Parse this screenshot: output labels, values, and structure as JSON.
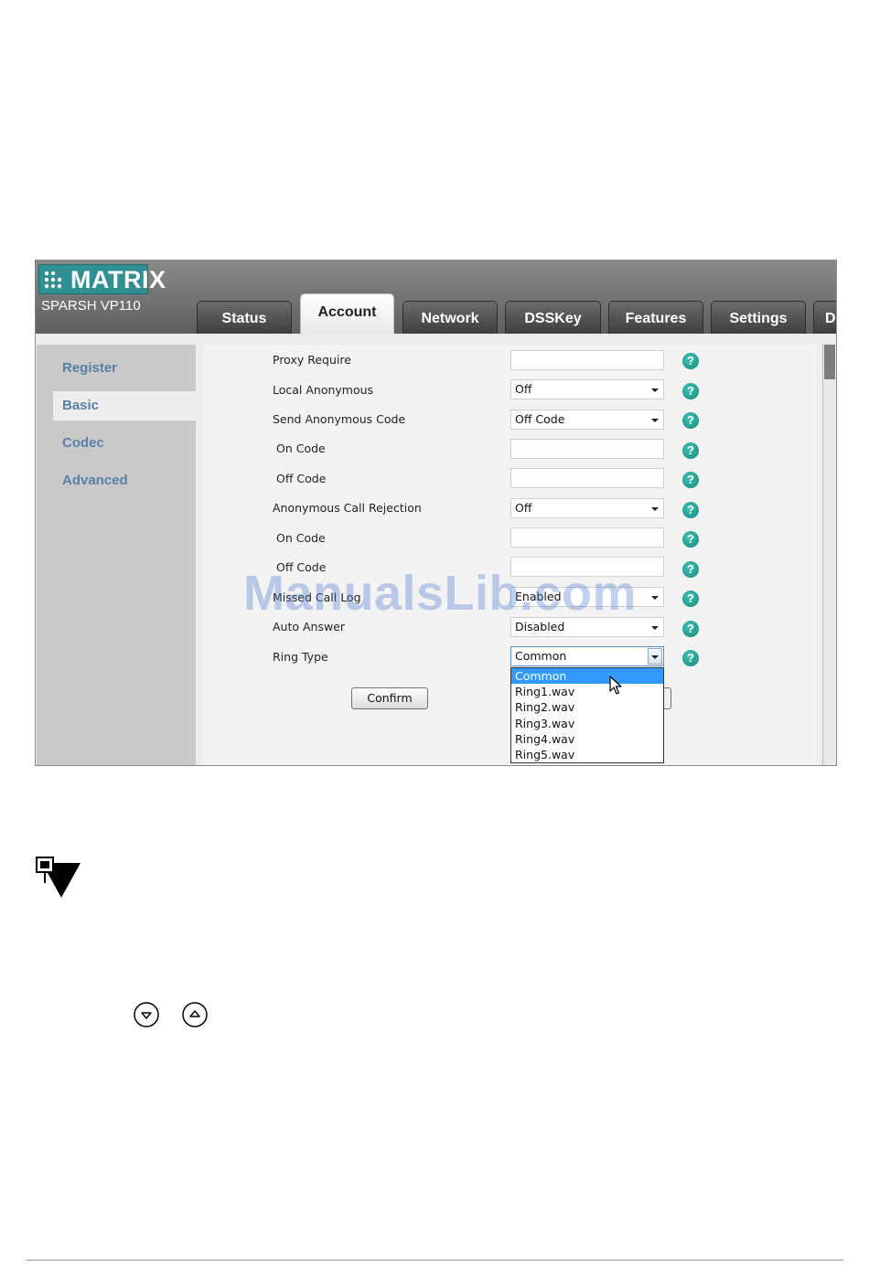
{
  "header": {
    "logo_text": "MATRIX",
    "model": "SPARSH VP110"
  },
  "tabs": [
    {
      "label": "Status",
      "active": false
    },
    {
      "label": "Account",
      "active": true
    },
    {
      "label": "Network",
      "active": false
    },
    {
      "label": "DSSKey",
      "active": false
    },
    {
      "label": "Features",
      "active": false
    },
    {
      "label": "Settings",
      "active": false
    },
    {
      "label": "D",
      "active": false
    }
  ],
  "sidebar": {
    "items": [
      {
        "label": "Register",
        "active": false
      },
      {
        "label": "Basic",
        "active": true
      },
      {
        "label": "Codec",
        "active": false
      },
      {
        "label": "Advanced",
        "active": false
      }
    ]
  },
  "form": {
    "rows": [
      {
        "label": "Proxy Require",
        "type": "text",
        "value": ""
      },
      {
        "label": "Local Anonymous",
        "type": "select",
        "value": "Off"
      },
      {
        "label": "Send Anonymous Code",
        "type": "select",
        "value": "Off Code"
      },
      {
        "label": "On Code",
        "type": "text",
        "value": ""
      },
      {
        "label": "Off Code",
        "type": "text",
        "value": ""
      },
      {
        "label": "Anonymous Call Rejection",
        "type": "select",
        "value": "Off"
      },
      {
        "label": "On Code",
        "type": "text",
        "value": ""
      },
      {
        "label": "Off Code",
        "type": "text",
        "value": ""
      },
      {
        "label": "Missed Call Log",
        "type": "select",
        "value": "Enabled"
      },
      {
        "label": "Auto Answer",
        "type": "select",
        "value": "Disabled"
      },
      {
        "label": "Ring Type",
        "type": "select-open",
        "value": "Common"
      }
    ],
    "help_symbol": "?",
    "confirm_label": "Confirm"
  },
  "ring_dropdown": {
    "options": [
      "Common",
      "Ring1.wav",
      "Ring2.wav",
      "Ring3.wav",
      "Ring4.wav",
      "Ring5.wav"
    ],
    "highlighted": "Common"
  },
  "watermark": "ManualsLib.com",
  "icons": {
    "note": "note-pin-icon",
    "down_key": "down-arrow-key-icon",
    "up_key": "up-arrow-key-icon"
  },
  "colors": {
    "tab_bar": "#5f5f5f",
    "logo_bg": "#2f8f93",
    "sidebar_link": "#5a7fa7",
    "help_icon": "#14897c",
    "dropdown_highlight": "#3399ff"
  }
}
